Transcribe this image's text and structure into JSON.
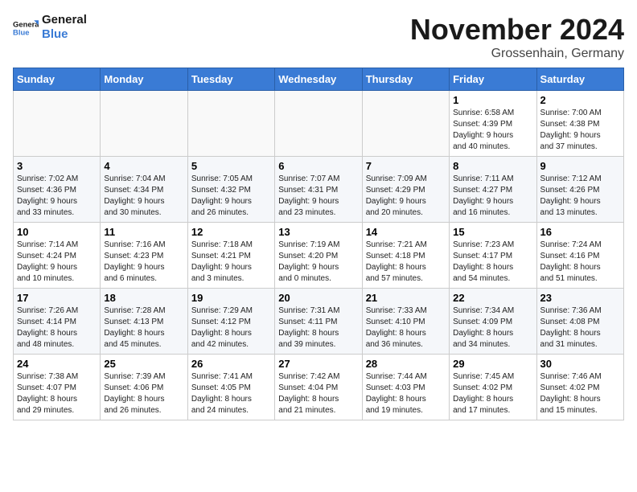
{
  "logo": {
    "line1": "General",
    "line2": "Blue"
  },
  "title": "November 2024",
  "location": "Grossenhain, Germany",
  "days_header": [
    "Sunday",
    "Monday",
    "Tuesday",
    "Wednesday",
    "Thursday",
    "Friday",
    "Saturday"
  ],
  "weeks": [
    [
      {
        "day": "",
        "info": ""
      },
      {
        "day": "",
        "info": ""
      },
      {
        "day": "",
        "info": ""
      },
      {
        "day": "",
        "info": ""
      },
      {
        "day": "",
        "info": ""
      },
      {
        "day": "1",
        "info": "Sunrise: 6:58 AM\nSunset: 4:39 PM\nDaylight: 9 hours\nand 40 minutes."
      },
      {
        "day": "2",
        "info": "Sunrise: 7:00 AM\nSunset: 4:38 PM\nDaylight: 9 hours\nand 37 minutes."
      }
    ],
    [
      {
        "day": "3",
        "info": "Sunrise: 7:02 AM\nSunset: 4:36 PM\nDaylight: 9 hours\nand 33 minutes."
      },
      {
        "day": "4",
        "info": "Sunrise: 7:04 AM\nSunset: 4:34 PM\nDaylight: 9 hours\nand 30 minutes."
      },
      {
        "day": "5",
        "info": "Sunrise: 7:05 AM\nSunset: 4:32 PM\nDaylight: 9 hours\nand 26 minutes."
      },
      {
        "day": "6",
        "info": "Sunrise: 7:07 AM\nSunset: 4:31 PM\nDaylight: 9 hours\nand 23 minutes."
      },
      {
        "day": "7",
        "info": "Sunrise: 7:09 AM\nSunset: 4:29 PM\nDaylight: 9 hours\nand 20 minutes."
      },
      {
        "day": "8",
        "info": "Sunrise: 7:11 AM\nSunset: 4:27 PM\nDaylight: 9 hours\nand 16 minutes."
      },
      {
        "day": "9",
        "info": "Sunrise: 7:12 AM\nSunset: 4:26 PM\nDaylight: 9 hours\nand 13 minutes."
      }
    ],
    [
      {
        "day": "10",
        "info": "Sunrise: 7:14 AM\nSunset: 4:24 PM\nDaylight: 9 hours\nand 10 minutes."
      },
      {
        "day": "11",
        "info": "Sunrise: 7:16 AM\nSunset: 4:23 PM\nDaylight: 9 hours\nand 6 minutes."
      },
      {
        "day": "12",
        "info": "Sunrise: 7:18 AM\nSunset: 4:21 PM\nDaylight: 9 hours\nand 3 minutes."
      },
      {
        "day": "13",
        "info": "Sunrise: 7:19 AM\nSunset: 4:20 PM\nDaylight: 9 hours\nand 0 minutes."
      },
      {
        "day": "14",
        "info": "Sunrise: 7:21 AM\nSunset: 4:18 PM\nDaylight: 8 hours\nand 57 minutes."
      },
      {
        "day": "15",
        "info": "Sunrise: 7:23 AM\nSunset: 4:17 PM\nDaylight: 8 hours\nand 54 minutes."
      },
      {
        "day": "16",
        "info": "Sunrise: 7:24 AM\nSunset: 4:16 PM\nDaylight: 8 hours\nand 51 minutes."
      }
    ],
    [
      {
        "day": "17",
        "info": "Sunrise: 7:26 AM\nSunset: 4:14 PM\nDaylight: 8 hours\nand 48 minutes."
      },
      {
        "day": "18",
        "info": "Sunrise: 7:28 AM\nSunset: 4:13 PM\nDaylight: 8 hours\nand 45 minutes."
      },
      {
        "day": "19",
        "info": "Sunrise: 7:29 AM\nSunset: 4:12 PM\nDaylight: 8 hours\nand 42 minutes."
      },
      {
        "day": "20",
        "info": "Sunrise: 7:31 AM\nSunset: 4:11 PM\nDaylight: 8 hours\nand 39 minutes."
      },
      {
        "day": "21",
        "info": "Sunrise: 7:33 AM\nSunset: 4:10 PM\nDaylight: 8 hours\nand 36 minutes."
      },
      {
        "day": "22",
        "info": "Sunrise: 7:34 AM\nSunset: 4:09 PM\nDaylight: 8 hours\nand 34 minutes."
      },
      {
        "day": "23",
        "info": "Sunrise: 7:36 AM\nSunset: 4:08 PM\nDaylight: 8 hours\nand 31 minutes."
      }
    ],
    [
      {
        "day": "24",
        "info": "Sunrise: 7:38 AM\nSunset: 4:07 PM\nDaylight: 8 hours\nand 29 minutes."
      },
      {
        "day": "25",
        "info": "Sunrise: 7:39 AM\nSunset: 4:06 PM\nDaylight: 8 hours\nand 26 minutes."
      },
      {
        "day": "26",
        "info": "Sunrise: 7:41 AM\nSunset: 4:05 PM\nDaylight: 8 hours\nand 24 minutes."
      },
      {
        "day": "27",
        "info": "Sunrise: 7:42 AM\nSunset: 4:04 PM\nDaylight: 8 hours\nand 21 minutes."
      },
      {
        "day": "28",
        "info": "Sunrise: 7:44 AM\nSunset: 4:03 PM\nDaylight: 8 hours\nand 19 minutes."
      },
      {
        "day": "29",
        "info": "Sunrise: 7:45 AM\nSunset: 4:02 PM\nDaylight: 8 hours\nand 17 minutes."
      },
      {
        "day": "30",
        "info": "Sunrise: 7:46 AM\nSunset: 4:02 PM\nDaylight: 8 hours\nand 15 minutes."
      }
    ]
  ]
}
